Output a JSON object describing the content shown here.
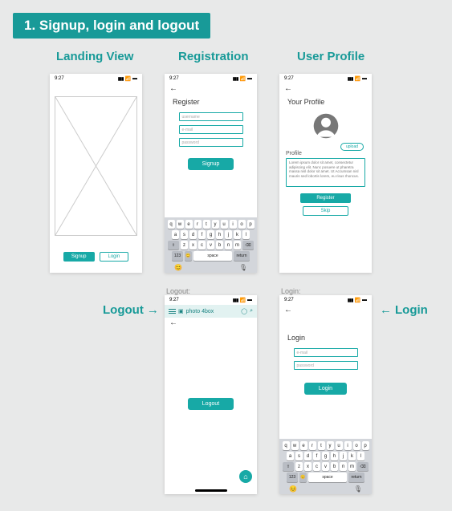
{
  "heading": "1.  Signup, login and logout",
  "labels": {
    "landing": "Landing View",
    "registration": "Registration",
    "profile": "User Profile",
    "logout": "Logout",
    "login": "Login",
    "logout_caption": "Logout:",
    "login_caption": "Login:"
  },
  "status": {
    "time": "9:27"
  },
  "landing": {
    "signup": "Signup",
    "login": "Login"
  },
  "registration": {
    "title": "Register",
    "username_ph": "username",
    "email_ph": "e-mail",
    "password_ph": "password",
    "button": "Signup"
  },
  "profile": {
    "title": "Your Profile",
    "upload": "upload",
    "section_label": "Profile",
    "lorem": "Lorem ipsum dolor sit amet, consectetur adipiscing elit. Nunc posuere ut pharetra massa nisl dolor sit amet. Ut Accumsan nisl mauris sed lobortis lorem, eu risus rhoncus.",
    "register": "Register",
    "skip": "Skip"
  },
  "logout": {
    "brand": "photo 4box",
    "button": "Logout"
  },
  "login": {
    "title": "Login",
    "email_ph": "e-mail",
    "password_ph": "password",
    "button": "Login"
  },
  "keyboard": {
    "row1": [
      "q",
      "w",
      "e",
      "r",
      "t",
      "y",
      "u",
      "i",
      "o",
      "p"
    ],
    "row2": [
      "a",
      "s",
      "d",
      "f",
      "g",
      "h",
      "j",
      "k",
      "l"
    ],
    "row3": [
      "z",
      "x",
      "c",
      "v",
      "b",
      "n",
      "m"
    ],
    "shift": "⇧",
    "backspace": "⌫",
    "numkey": "123",
    "space": "space",
    "return": "return",
    "emoji": "😊",
    "mic": "🎙"
  }
}
